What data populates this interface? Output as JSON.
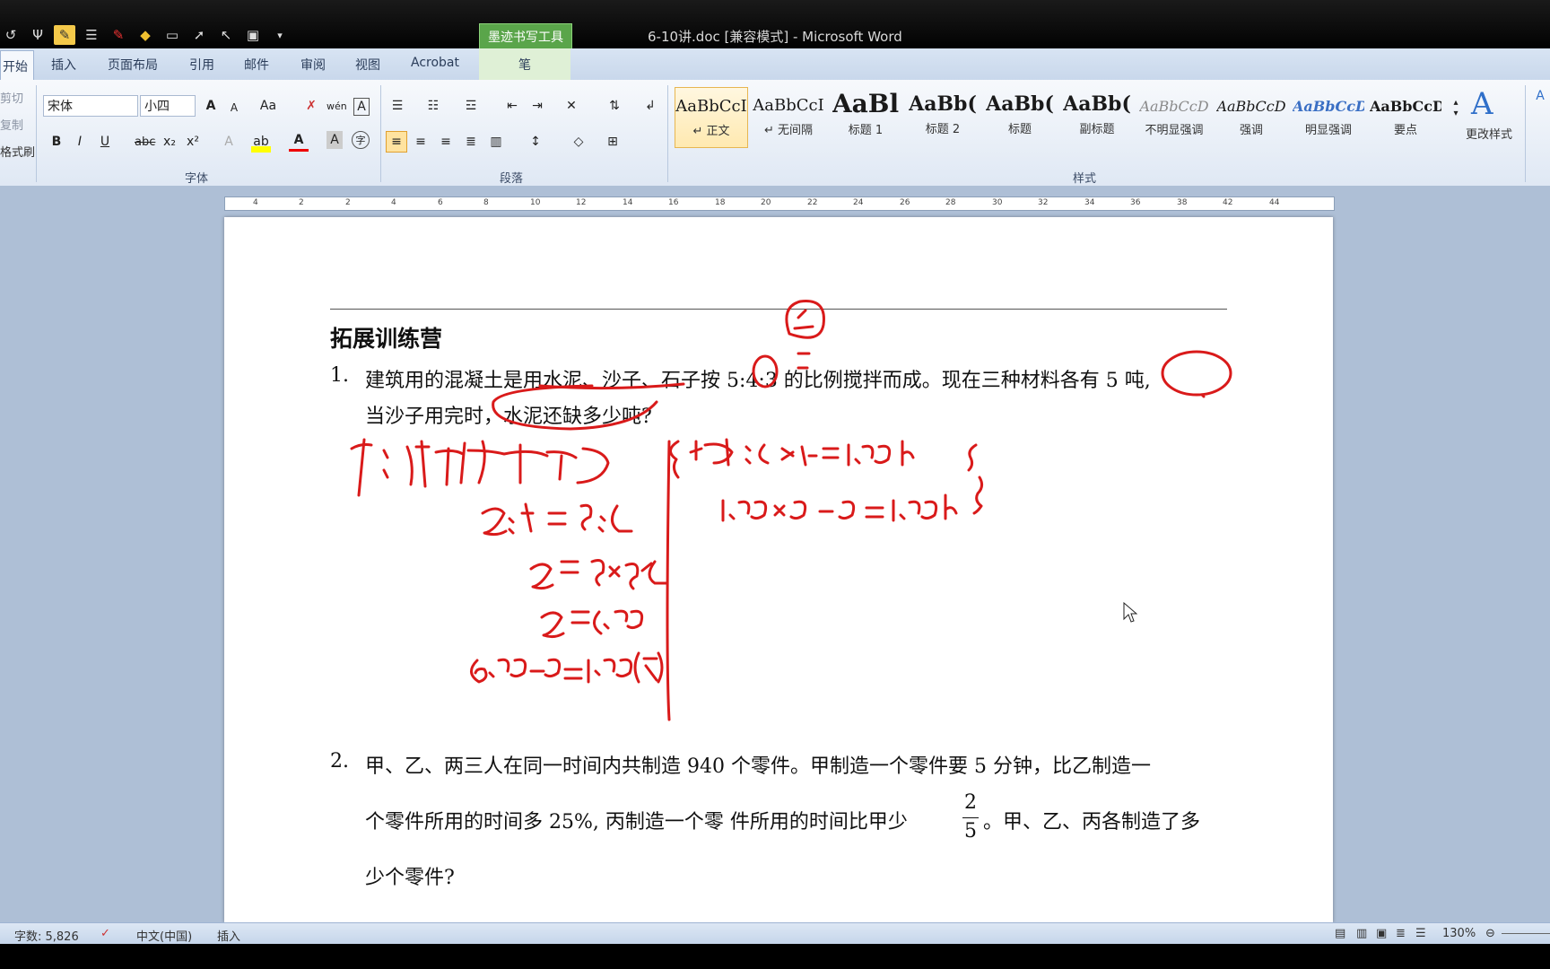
{
  "window": {
    "title": "6-10讲.doc [兼容模式] - Microsoft Word",
    "contextual_tab_group": "墨迹书写工具"
  },
  "tabs": [
    {
      "label": "开始"
    },
    {
      "label": "插入"
    },
    {
      "label": "页面布局"
    },
    {
      "label": "引用"
    },
    {
      "label": "邮件"
    },
    {
      "label": "审阅"
    },
    {
      "label": "视图"
    },
    {
      "label": "Acrobat"
    },
    {
      "label": "笔"
    }
  ],
  "ribbon": {
    "clipboard": {
      "cut": "剪切",
      "copy": "复制",
      "format_painter": "格式刷"
    },
    "font": {
      "group_label": "字体",
      "font_name": "宋体",
      "font_size": "小四",
      "grow": "A",
      "shrink": "A",
      "change_case": "Aa",
      "bold": "B",
      "italic": "I",
      "underline": "U",
      "strike": "abc",
      "subscript": "x₂",
      "superscript": "x²",
      "font_color": "A",
      "char_border": "A",
      "phonetic": "wén",
      "enclose": "字"
    },
    "paragraph": {
      "group_label": "段落"
    },
    "styles": {
      "group_label": "样式",
      "items": [
        {
          "sample": "AaBbCcI",
          "name": "↵ 正文"
        },
        {
          "sample": "AaBbCcI",
          "name": "↵ 无间隔"
        },
        {
          "sample": "AaBl",
          "name": "标题 1"
        },
        {
          "sample": "AaBb(",
          "name": "标题 2"
        },
        {
          "sample": "AaBb(",
          "name": "标题"
        },
        {
          "sample": "AaBb(",
          "name": "副标题"
        },
        {
          "sample": "AaBbCcD",
          "name": "不明显强调"
        },
        {
          "sample": "AaBbCcD",
          "name": "强调"
        },
        {
          "sample": "AaBbCcD",
          "name": "明显强调"
        },
        {
          "sample": "AaBbCcD",
          "name": "要点"
        }
      ],
      "change_styles": "更改样式"
    }
  },
  "ruler": {
    "ticks": [
      "4",
      "2",
      "2",
      "4",
      "6",
      "8",
      "10",
      "12",
      "14",
      "16",
      "18",
      "20",
      "22",
      "24",
      "26",
      "28",
      "30",
      "32",
      "34",
      "36",
      "38",
      "42",
      "44"
    ]
  },
  "document": {
    "heading": "拓展训练营",
    "q1": {
      "number": "1.",
      "line1": "建筑用的混凝土是用水泥、沙子、石子按 5:4:3 的比例搅拌而成。现在三种材料各有 5 吨,",
      "line2": "当沙子用完时，水泥还缺多少吨?"
    },
    "q2": {
      "number": "2.",
      "line1": "甲、乙、两三人在同一时间内共制造 940 个零件。甲制造一个零件要 5 分钟，比乙制造一",
      "line2": "个零件所用的时间多 25%, 丙制造一个零  件所用的时间比甲少",
      "frac_num": "2",
      "frac_den": "5",
      "line2_tail": "。甲、乙、丙各制造了多",
      "line3": "少个零件?"
    }
  },
  "statusbar": {
    "word_count": "字数: 5,826",
    "language": "中文(中国)",
    "mode": "插入",
    "zoom": "130%"
  },
  "colors": {
    "ink": "#d91a1a",
    "ribbon_bg": "#dfe8f4",
    "page_bg": "#ffffff",
    "workspace": "#aebfd6",
    "ink_tab": "#5aa54a"
  }
}
